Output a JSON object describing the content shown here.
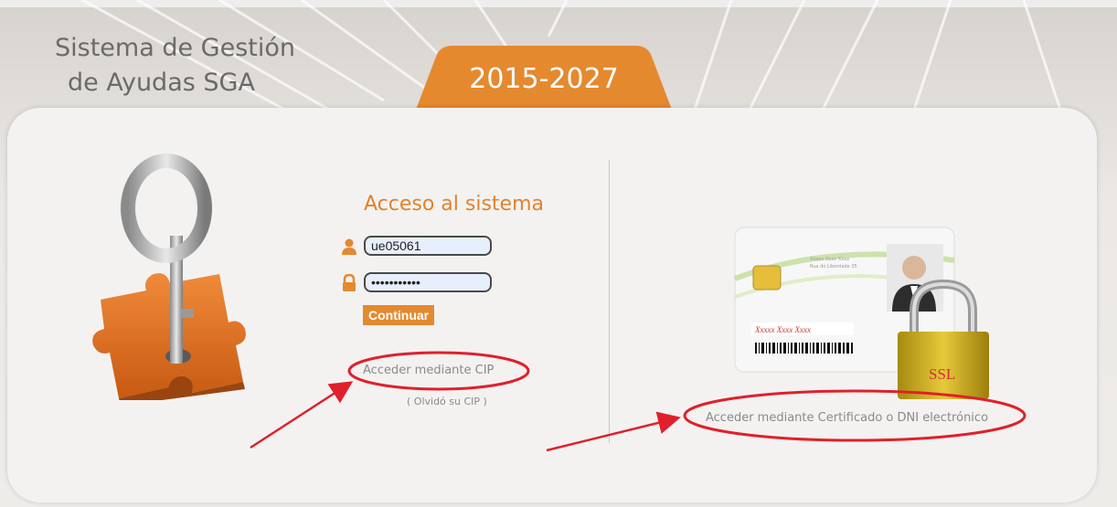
{
  "header": {
    "title_line1": "Sistema de Gestión",
    "title_line2": "de Ayudas SGA",
    "years": "2015-2027"
  },
  "login": {
    "title": "Acceso al sistema",
    "username_value": "ue05061",
    "password_value": "•••••••••••",
    "continue_label": "Continuar",
    "cip_link": "Acceder mediante CIP",
    "forgot_link": "( Olvidó su CIP )"
  },
  "certificate": {
    "card_name": "Xxxxx Xxxx Xxxx",
    "card_small_line1": "Xxxxx Xxxx Xxxx",
    "card_small_line2": "Rua do Liberdade 35",
    "lock_label": "SSL",
    "link": "Acceder mediante Certificado o DNI electrónico"
  },
  "colors": {
    "accent_orange": "#e5892f",
    "annotation_red": "#e0202a",
    "panel_bg": "#f3f2f1"
  },
  "icons": [
    "user-icon",
    "lock-icon",
    "key-puzzle-image",
    "id-card-image",
    "padlock-image"
  ]
}
